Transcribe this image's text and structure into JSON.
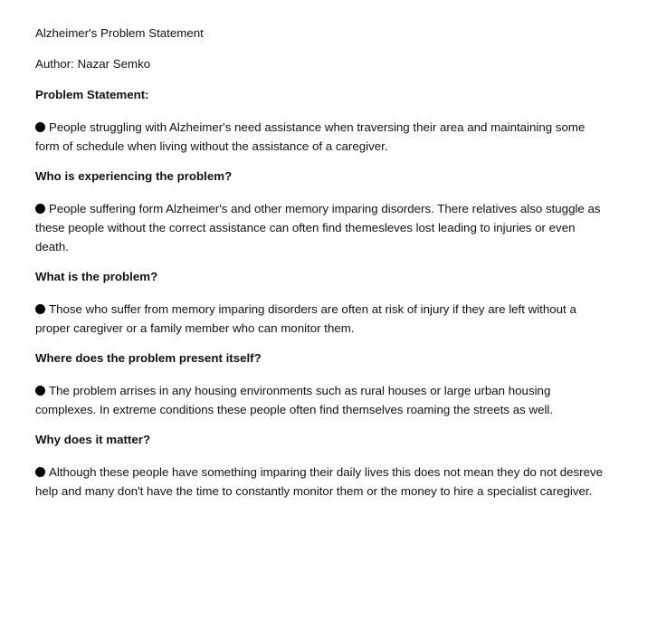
{
  "document": {
    "title": "Alzheimer's Problem Statement",
    "author": "Author: Nazar Semko",
    "sections": [
      {
        "heading": "Problem Statement:",
        "text": "People struggling with Alzheimer's need assistance when traversing their area and maintaining some form of schedule when living without the assistance of a caregiver."
      },
      {
        "heading": "Who is experiencing the problem?",
        "text": "People suffering form Alzheimer's and other memory imparing disorders. There relatives also stuggle as these people without the correct assistance can often find themesleves lost leading to injuries or even death."
      },
      {
        "heading": "What is the problem?",
        "text": "Those who suffer from memory imparing disorders are often at risk of injury if they are left without a proper caregiver or a family member who can monitor them."
      },
      {
        "heading": "Where does the problem present itself?",
        "text": "The problem arrises in any housing environments such as rural houses or large urban housing complexes. In extreme conditions these people often find themselves roaming the streets as well."
      },
      {
        "heading": "Why does it matter?",
        "text": "Although these people have something imparing their daily lives this does not mean they do not desreve help and many don't have the time to constantly monitor them or the money to hire a specialist caregiver."
      }
    ]
  }
}
